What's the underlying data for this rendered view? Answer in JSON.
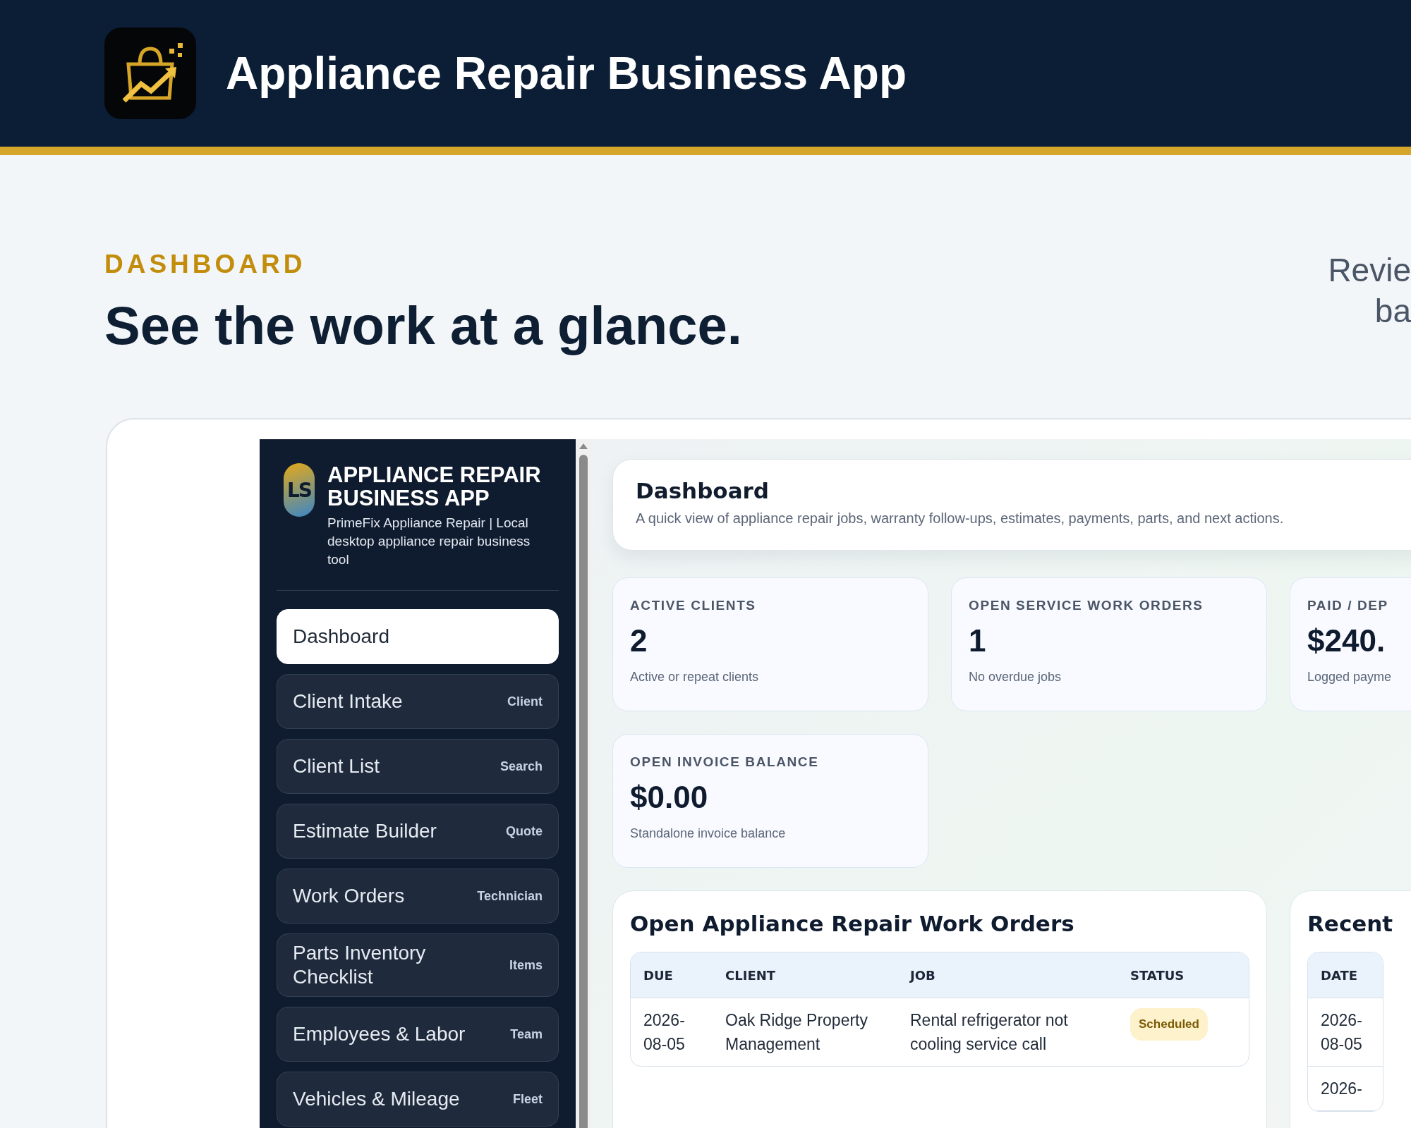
{
  "header": {
    "title": "Appliance Repair Business App"
  },
  "hero": {
    "eyebrow": "DASHBOARD",
    "headline": "See the work at a glance.",
    "aside_lines": [
      "Revie",
      "ba"
    ]
  },
  "app": {
    "brand": {
      "logo_text": "LS",
      "title": "APPLIANCE REPAIR BUSINESS APP",
      "subtitle": "PrimeFix Appliance Repair | Local desktop appliance repair business tool"
    },
    "nav": [
      {
        "label": "Dashboard",
        "selected": true
      },
      {
        "label": "Client Intake",
        "tag": "Client",
        "selected": false
      },
      {
        "label": "Client List",
        "tag": "Search",
        "selected": false
      },
      {
        "label": "Estimate Builder",
        "tag": "Quote",
        "selected": false
      },
      {
        "label": "Work Orders",
        "tag": "Technician",
        "selected": false
      },
      {
        "label": "Parts Inventory Checklist",
        "tag": "Items",
        "selected": false
      },
      {
        "label": "Employees & Labor",
        "tag": "Team",
        "selected": false
      },
      {
        "label": "Vehicles & Mileage",
        "tag": "Fleet",
        "selected": false
      }
    ],
    "page": {
      "title": "Dashboard",
      "subtitle": "A quick view of appliance repair jobs, warranty follow-ups, estimates, payments, parts, and next actions."
    },
    "stats": [
      {
        "label": "ACTIVE CLIENTS",
        "value": "2",
        "note": "Active or repeat clients"
      },
      {
        "label": "OPEN SERVICE WORK ORDERS",
        "value": "1",
        "note": "No overdue jobs"
      },
      {
        "label": "PAID / DEP",
        "value": "$240.",
        "note": "Logged payme"
      },
      {
        "label": "OPEN INVOICE BALANCE",
        "value": "$0.00",
        "note": "Standalone invoice balance"
      }
    ],
    "work_orders": {
      "title": "Open Appliance Repair Work Orders",
      "columns": [
        "DUE",
        "CLIENT",
        "JOB",
        "STATUS"
      ],
      "rows": [
        {
          "due": "2026-08-05",
          "client": "Oak Ridge Property Management",
          "job": "Rental refrigerator not cooling service call",
          "status": {
            "label": "Scheduled",
            "kind": "scheduled"
          }
        }
      ]
    },
    "recent": {
      "title": "Recent",
      "columns": [
        "DATE"
      ],
      "rows": [
        {
          "date": "2026-08-05"
        },
        {
          "date": "2026-"
        }
      ]
    }
  }
}
